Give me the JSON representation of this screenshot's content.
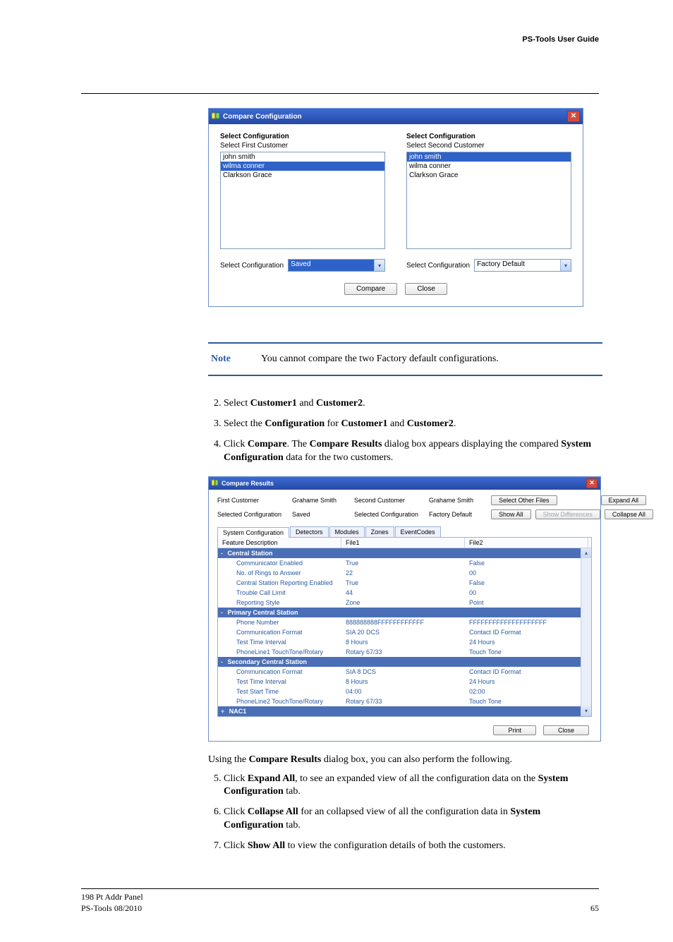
{
  "header": {
    "title": "PS-Tools User Guide"
  },
  "dlg1": {
    "title": "Compare Configuration",
    "left": {
      "heading": "Select Configuration",
      "sub": "Select First Customer",
      "items": [
        "john smith",
        "wilma conner",
        "Clarkson Grace"
      ],
      "selected_index": 1,
      "select_label": "Select Configuration",
      "select_value": "Saved"
    },
    "right": {
      "heading": "Select Configuration",
      "sub": "Select Second Customer",
      "items": [
        "john smith",
        "wilma conner",
        "Clarkson Grace"
      ],
      "selected_index": 0,
      "select_label": "Select Configuration",
      "select_value": "Factory Default"
    },
    "compare_btn": "Compare",
    "close_btn": "Close"
  },
  "note": {
    "label": "Note",
    "text": "You cannot compare the two Factory default configurations."
  },
  "steps_a": [
    {
      "n": "2.",
      "html_parts": [
        "Select ",
        "Customer1",
        " and ",
        "Customer2",
        "."
      ]
    },
    {
      "n": "3.",
      "html_parts": [
        "Select the ",
        "Configuration",
        " for ",
        "Customer1",
        " and ",
        "Customer2",
        "."
      ]
    },
    {
      "n": "4.",
      "html_parts": [
        "Click ",
        "Compare",
        ". The ",
        "Compare Results",
        " dialog box appears displaying the compared ",
        "System Configuration",
        " data for the two customers."
      ]
    }
  ],
  "dlg2": {
    "title": "Compare Results",
    "labels": {
      "first_customer_lbl": "First Customer",
      "first_customer_val": "Grahame Smith",
      "second_customer_lbl": "Second Customer",
      "second_customer_val": "Grahame Smith",
      "sel_cfg_lbl_l": "Selected Configuration",
      "sel_cfg_val_l": "Saved",
      "sel_cfg_lbl_r": "Selected Configuration",
      "sel_cfg_val_r": "Factory Default",
      "select_other_btn": "Select Other Files",
      "expand_btn": "Expand All",
      "show_all_btn": "Show All",
      "show_diff_btn": "Show Differences",
      "collapse_btn": "Collapse All"
    },
    "tabs": [
      "System Configuration",
      "Detectors",
      "Modules",
      "Zones",
      "EventCodes"
    ],
    "active_tab": 0,
    "grid_head": [
      "Feature Description",
      "File1",
      "File2"
    ],
    "groups": [
      {
        "name": "Central Station",
        "rows": [
          [
            "Communicator Enabled",
            "True",
            "False"
          ],
          [
            "No. of Rings to Answer",
            "22",
            "00"
          ],
          [
            "Central Station Reporting Enabled",
            "True",
            "False"
          ],
          [
            "Trouble Call Limit",
            "44",
            "00"
          ],
          [
            "Reporting Style",
            "Zone",
            "Point"
          ]
        ]
      },
      {
        "name": "Primary Central Station",
        "rows": [
          [
            "Phone Number",
            "888888888FFFFFFFFFFFF",
            "FFFFFFFFFFFFFFFFFFFF"
          ],
          [
            "Communication Format",
            "SIA 20 DCS",
            "Contact ID Format"
          ],
          [
            "Test Time Interval",
            "8 Hours",
            "24 Hours"
          ],
          [
            "PhoneLine1 TouchTone/Rotary",
            "Rotary 67/33",
            "Touch Tone"
          ]
        ]
      },
      {
        "name": "Secondary Central Station",
        "rows": [
          [
            "Communication Format",
            "SIA 8 DCS",
            "Contact ID Format"
          ],
          [
            "Test Time Interval",
            "8 Hours",
            "24 Hours"
          ],
          [
            "Test Start Time",
            "04:00",
            "02:00"
          ],
          [
            "PhoneLine2 TouchTone/Rotary",
            "Rotary 67/33",
            "Touch Tone"
          ]
        ]
      },
      {
        "name": "NAC1",
        "rows": []
      }
    ],
    "print_btn": "Print",
    "close_btn": "Close"
  },
  "after_para": [
    "Using the ",
    "Compare Results",
    " dialog box, you can also perform the following."
  ],
  "steps_b": [
    {
      "n": "5.",
      "html_parts": [
        "Click ",
        "Expand All",
        ", to see an expanded view of all the configuration data on the ",
        "System Configuration",
        " tab."
      ]
    },
    {
      "n": "6.",
      "html_parts": [
        "Click ",
        "Collapse All",
        " for an collapsed view of all the configuration data in ",
        "System Configuration",
        " tab."
      ]
    },
    {
      "n": "7.",
      "html_parts": [
        "Click ",
        "Show All",
        " to view the configuration details of both the customers."
      ]
    }
  ],
  "footer": {
    "line1": "198 Pt Addr Panel",
    "line2": "PS-Tools  08/2010",
    "page": "65"
  }
}
